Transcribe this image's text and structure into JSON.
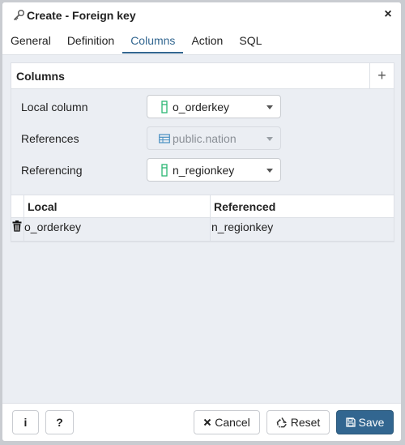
{
  "window": {
    "title": "Create - Foreign key",
    "close_symbol": "×",
    "title_icon": "key-icon"
  },
  "tabs": [
    {
      "label": "General"
    },
    {
      "label": "Definition"
    },
    {
      "label": "Columns",
      "active": true
    },
    {
      "label": "Action"
    },
    {
      "label": "SQL"
    }
  ],
  "columns_section": {
    "title": "Columns",
    "add_symbol": "+"
  },
  "form": {
    "local_column": {
      "label": "Local column",
      "value": "o_orderkey",
      "icon": "column-icon"
    },
    "references": {
      "label": "References",
      "value": "public.nation",
      "icon": "table-icon",
      "disabled": true
    },
    "referencing": {
      "label": "Referencing",
      "value": "n_regionkey",
      "icon": "column-icon"
    }
  },
  "grid": {
    "headers": {
      "local": "Local",
      "referenced": "Referenced"
    },
    "rows": [
      {
        "local": "o_orderkey",
        "referenced": "n_regionkey"
      }
    ]
  },
  "footer": {
    "info_label": "i",
    "help_label": "?",
    "cancel_label": "Cancel",
    "reset_label": "Reset",
    "save_label": "Save"
  },
  "colors": {
    "accent": "#326690",
    "column_icon": "#2bb673",
    "table_icon": "#4a90c2"
  }
}
